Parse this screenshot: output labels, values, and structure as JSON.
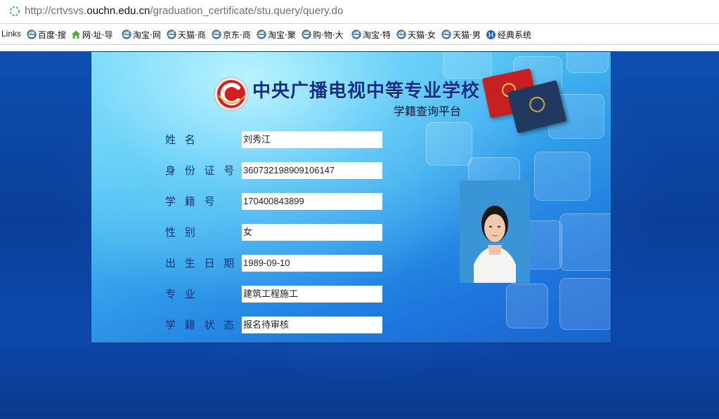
{
  "browser": {
    "url_prefix": "http://crtvsvs.",
    "url_host": "ouchn.edu.cn",
    "url_path": "/graduation_certificate/stu.query/query.do",
    "links_label": "Links",
    "links": [
      {
        "label": "百度·搜",
        "icon": "ie-icon"
      },
      {
        "label": "网·址·导",
        "icon": "home-icon"
      },
      {
        "label": "淘宝·网",
        "icon": "ie-icon"
      },
      {
        "label": "天猫·商",
        "icon": "ie-icon"
      },
      {
        "label": "京东·商",
        "icon": "ie-icon"
      },
      {
        "label": "淘宝·聚",
        "icon": "ie-icon"
      },
      {
        "label": "购·物·大",
        "icon": "ie-icon"
      },
      {
        "label": "淘宝·特",
        "icon": "ie-icon"
      },
      {
        "label": "天猫·女",
        "icon": "ie-icon"
      },
      {
        "label": "天猫·男",
        "icon": "ie-icon"
      },
      {
        "label": "经典系统",
        "icon": "globe-icon"
      }
    ]
  },
  "header": {
    "school_name": "中央广播电视中等专业学校",
    "subtitle": "学籍查询平台"
  },
  "fields": [
    {
      "label": "姓 名",
      "value": "刘秀江"
    },
    {
      "label": "身 份 证 号",
      "value": "360732198909106147"
    },
    {
      "label": "学 籍 号",
      "value": "170400843899"
    },
    {
      "label": "性 别",
      "value": "女"
    },
    {
      "label": "出 生 日 期",
      "value": "1989-09-10"
    },
    {
      "label": "专 业",
      "value": "建筑工程施工"
    },
    {
      "label": "学 籍 状 态",
      "value": "报名待审核"
    }
  ],
  "colors": {
    "panel_top": "#8fe7fb",
    "panel_bottom": "#1a63cf",
    "label_text": "#103677",
    "school_text": "#0f2e8e",
    "photo_bg": "#3b97d8"
  }
}
